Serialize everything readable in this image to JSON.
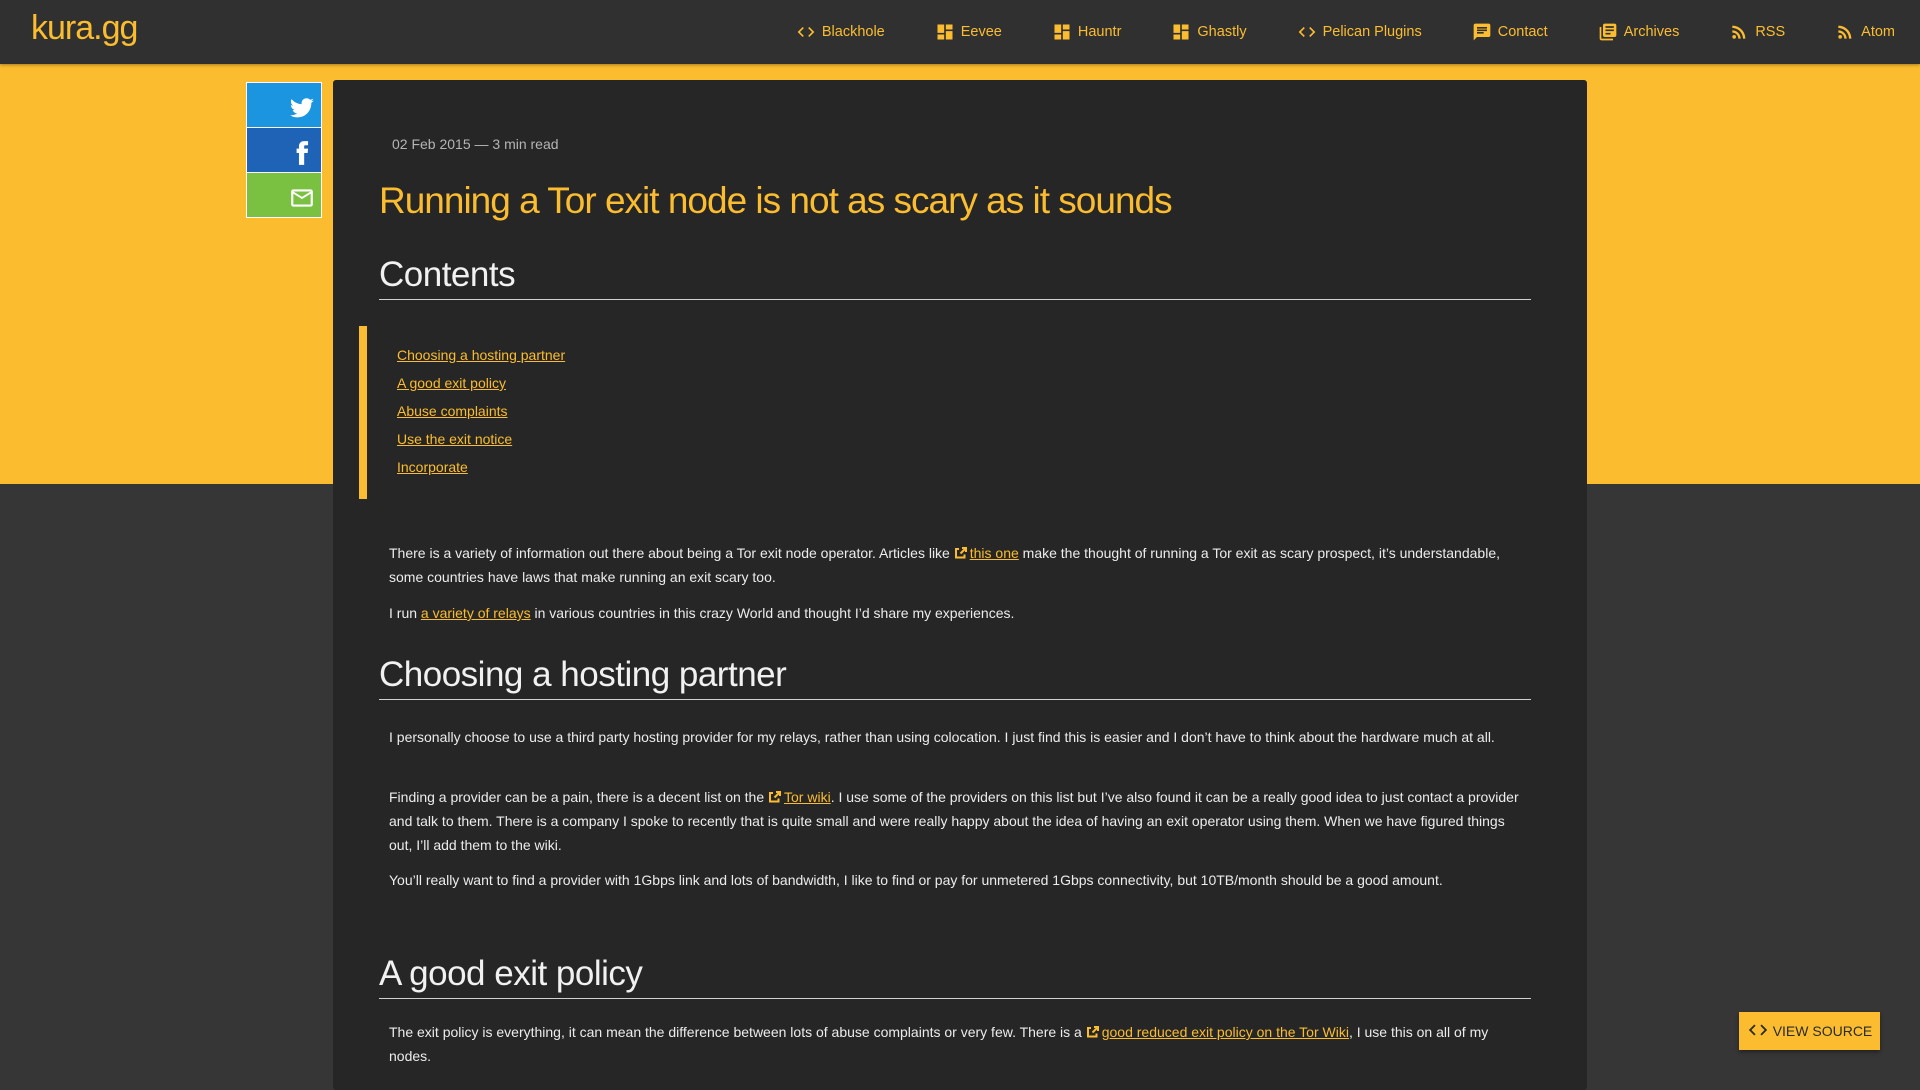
{
  "site": {
    "logo": "kura.gg"
  },
  "nav": [
    {
      "icon": "code-icon",
      "label": "Blackhole"
    },
    {
      "icon": "dashboard-icon",
      "label": "Eevee"
    },
    {
      "icon": "dashboard-icon",
      "label": "Hauntr"
    },
    {
      "icon": "dashboard-icon",
      "label": "Ghastly"
    },
    {
      "icon": "code-icon",
      "label": "Pelican Plugins"
    },
    {
      "icon": "chat-icon",
      "label": "Contact"
    },
    {
      "icon": "library-icon",
      "label": "Archives"
    },
    {
      "icon": "rss-icon",
      "label": "RSS"
    },
    {
      "icon": "rss-icon",
      "label": "Atom"
    }
  ],
  "share": {
    "twitter_icon": "twitter-icon",
    "facebook_icon": "facebook-icon",
    "email_icon": "mail-icon"
  },
  "article": {
    "meta": "02 Feb 2015 — 3 min read",
    "title": "Running a Tor exit node is not as scary as it sounds",
    "contents_heading": "Contents",
    "toc": [
      "Choosing a hosting partner",
      "A good exit policy",
      "Abuse complaints",
      "Use the exit notice",
      "Incorporate"
    ],
    "intro": {
      "p1_before": "There is a variety of information out there about being a Tor exit node operator. Articles like ",
      "p1_link": "this one",
      "p1_after": " make the thought of running a Tor exit as scary prospect, it’s understandable, some countries have laws that make running an exit scary too.",
      "p2_before": "I run ",
      "p2_link": "a variety of relays",
      "p2_after": " in various countries in this crazy World and thought I’d share my experiences."
    },
    "hosting": {
      "heading": "Choosing a hosting partner",
      "p1": "I personally choose to use a third party hosting provider for my relays, rather than using colocation. I just find this is easier and I don’t have to think about the hardware much at all.",
      "p2_before": "Finding a provider can be a pain, there is a decent list on the ",
      "p2_link": "Tor wiki",
      "p2_after": ". I use some of the providers on this list but I’ve also found it can be a really good idea to just contact a provider and talk to them. There is a company I spoke to recently that is quite small and were really happy about the idea of having an exit operator using them. When we have figured things out, I’ll add them to the wiki.",
      "p3": "You’ll really want to find a provider with 1Gbps link and lots of bandwidth, I like to find or pay for unmetered 1Gbps connectivity, but 10TB/month should be a good amount."
    },
    "policy": {
      "heading": "A good exit policy",
      "p1_before": "The exit policy is everything, it can mean the difference between lots of abuse complaints or very few. There is a ",
      "p1_link": "good reduced exit policy on the Tor Wiki",
      "p1_after": ", I use this on all of my nodes."
    }
  },
  "view_source": {
    "label": "VIEW SOURCE",
    "icon": "code-icon"
  },
  "colors": {
    "accent": "#fbbd2f",
    "header_bg": "#303030",
    "card_bg": "#262626",
    "page_bg": "#363636",
    "twitter": "#1b95e0",
    "facebook": "#1e63b5",
    "email": "#7ac142"
  }
}
